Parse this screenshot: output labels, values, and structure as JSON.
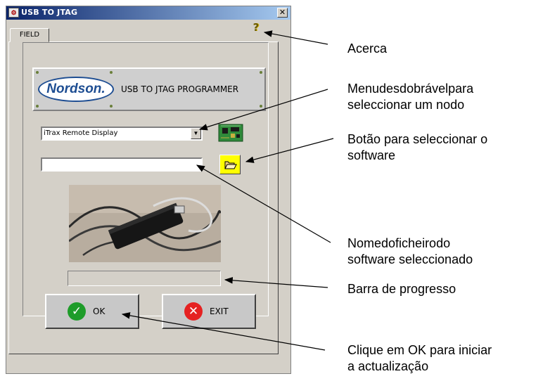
{
  "window": {
    "title": "USB TO JTAG",
    "close_glyph": "✕",
    "app_icon_glyph": "⚙"
  },
  "tab": {
    "label": "FIELD"
  },
  "help_icon": "?",
  "banner": {
    "logo_text": "Nordson.",
    "title": "USB TO JTAG PROGRAMMER"
  },
  "node_select": {
    "selected": "iTrax Remote Display",
    "arrow_glyph": "▼"
  },
  "software_file": {
    "value": ""
  },
  "progress": {
    "value": 0
  },
  "buttons": {
    "ok": {
      "label": "OK",
      "glyph": "✓"
    },
    "exit": {
      "label": "EXIT",
      "glyph": "✕"
    }
  },
  "callouts": {
    "about": "Acerca",
    "menu": [
      "Menu desdobrável para",
      "seleccionar um nodo"
    ],
    "select_software": [
      "Botão para seleccionar o",
      "software"
    ],
    "filename": [
      "Nome do ficheiro do",
      "software seleccionado"
    ],
    "progress": "Barra de progresso",
    "click_ok": [
      "Clique em OK para iniciar",
      "a actualização"
    ]
  },
  "colors": {
    "titlebar": "#0a246a",
    "window_bg": "#d4d0c8",
    "open_button": "#ffff00",
    "ok_green": "#1e9c2a",
    "exit_red": "#e52121",
    "logo_blue": "#1d4d92"
  }
}
